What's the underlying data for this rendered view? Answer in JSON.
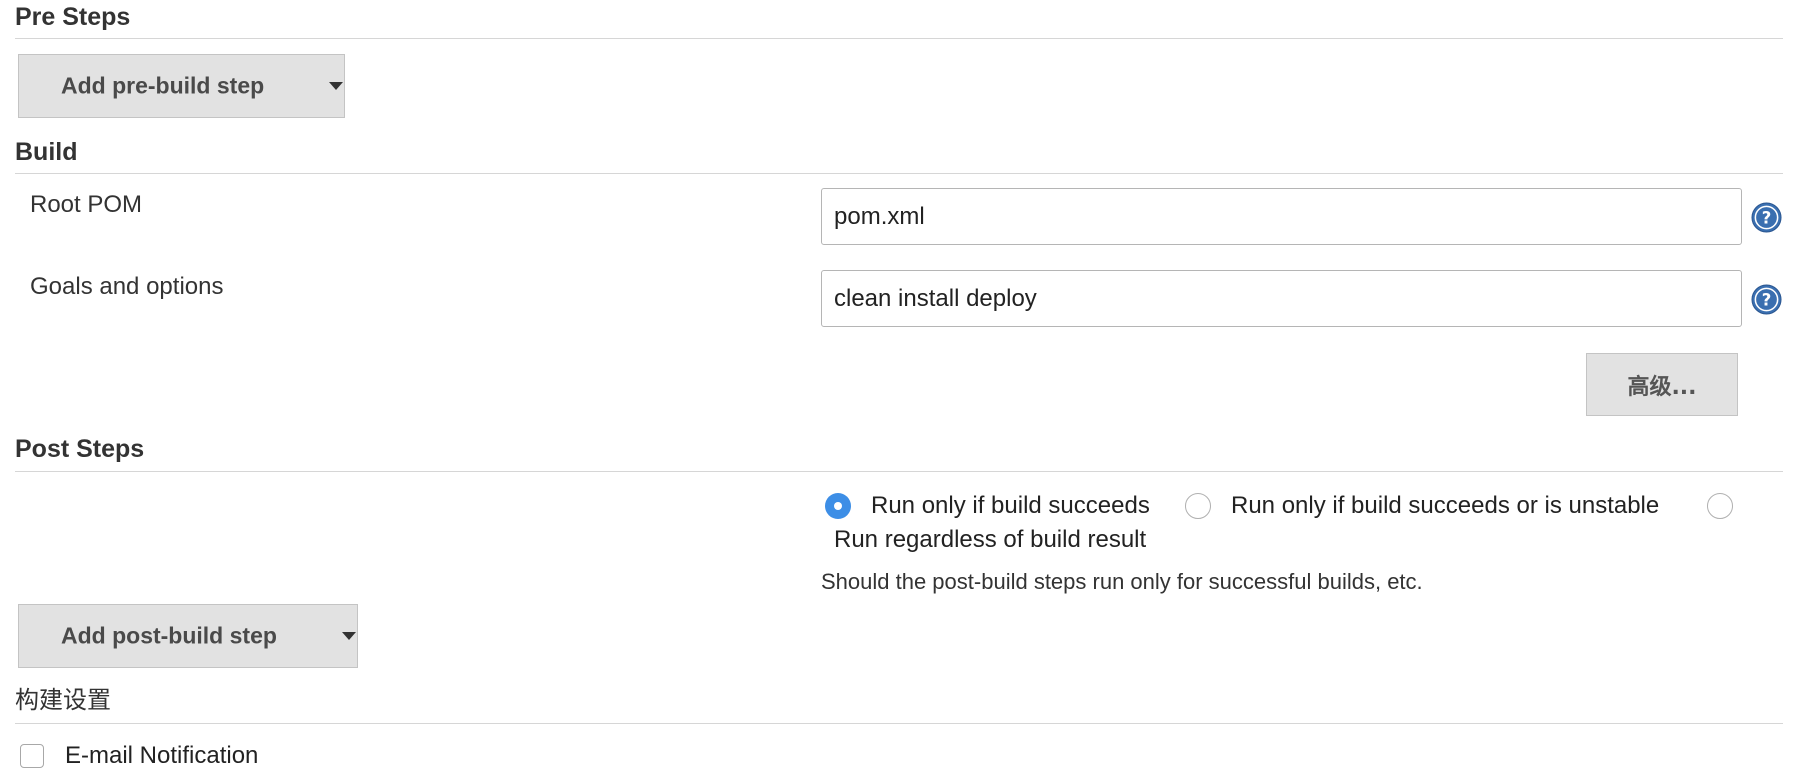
{
  "pre_steps": {
    "title": "Pre Steps",
    "add_button_label": "Add pre-build step"
  },
  "build": {
    "title": "Build",
    "root_pom": {
      "label": "Root POM",
      "value": "pom.xml",
      "help_icon": "help-icon"
    },
    "goals": {
      "label": "Goals and options",
      "value": "clean install deploy",
      "help_icon": "help-icon"
    },
    "advanced_button_label": "高级..."
  },
  "post_steps": {
    "title": "Post Steps",
    "run_condition": {
      "options": [
        {
          "label": "Run only if build succeeds",
          "checked": true
        },
        {
          "label": "Run only if build succeeds or is unstable",
          "checked": false
        },
        {
          "label": "Run regardless of build result",
          "checked": false
        }
      ],
      "description": "Should the post-build steps run only for successful builds, etc."
    },
    "add_button_label": "Add post-build step"
  },
  "build_settings": {
    "title": "构建设置",
    "email_notification": {
      "label": "E-mail Notification",
      "checked": false
    }
  },
  "colors": {
    "radio_selected": "#3d8ee6",
    "button_bg": "#e2e2e2",
    "help_icon_bg": "#3a6fb0"
  }
}
